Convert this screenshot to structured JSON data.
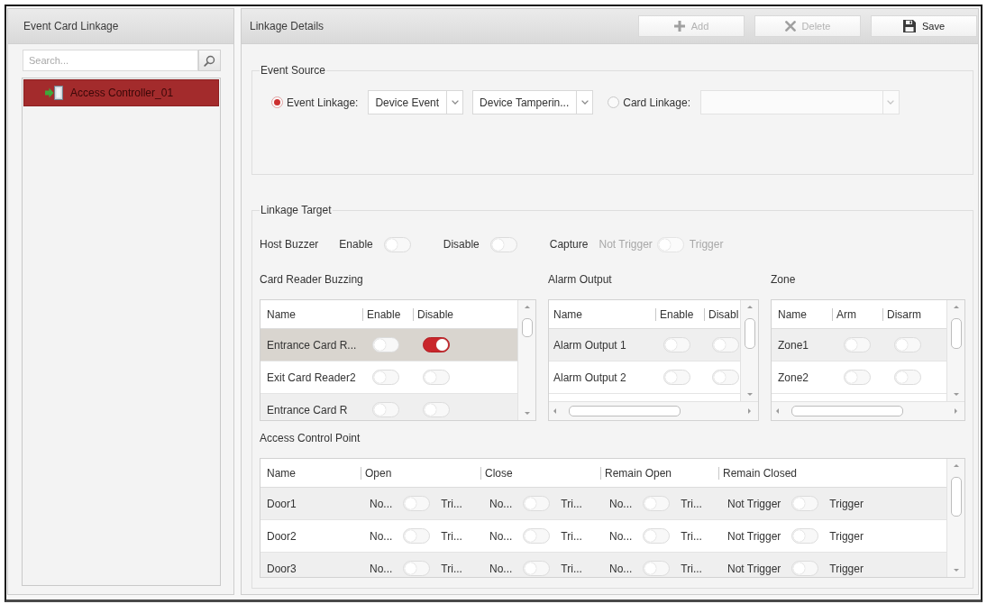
{
  "sidebar": {
    "title": "Event Card Linkage",
    "search": {
      "placeholder": "Search..."
    },
    "items": [
      {
        "label": "Access Controller_01",
        "selected": true
      }
    ]
  },
  "details": {
    "title": "Linkage Details",
    "buttons": [
      {
        "kind": "add",
        "label": "Add",
        "disabled": true
      },
      {
        "kind": "delete",
        "label": "Delete",
        "disabled": true
      },
      {
        "kind": "save",
        "label": "Save",
        "disabled": false
      }
    ],
    "event_source": {
      "title": "Event Source",
      "options": [
        {
          "label": "Event Linkage:",
          "selected": true,
          "dropdowns": [
            {
              "value": "Device Event",
              "disabled": false
            },
            {
              "value": "Device Tamperin...",
              "disabled": false
            }
          ]
        },
        {
          "label": "Card Linkage:",
          "selected": false,
          "dropdowns": [
            {
              "disabled": true
            }
          ]
        }
      ]
    },
    "linkage_target": {
      "title": "Linkage Target",
      "host_buzzer": {
        "label": "Host Buzzer",
        "options": [
          {
            "label": "Enable",
            "on": false
          },
          {
            "label": "Disable",
            "on": false
          }
        ]
      },
      "capture": {
        "label": "Capture",
        "off_label": "Not Trigger",
        "on_label": "Trigger",
        "on": false,
        "disabled": true
      },
      "card_reader_buzzing": {
        "title": "Card Reader Buzzing",
        "columns": [
          "Name",
          "Enable",
          "Disable"
        ],
        "rows": [
          {
            "name": "Entrance Card R...",
            "selected": true,
            "toggles": [
              {
                "on": false
              },
              {
                "on": true
              }
            ]
          },
          {
            "name": "Exit Card Reader2",
            "selected": false,
            "toggles": [
              {
                "on": false
              },
              {
                "on": false
              }
            ]
          },
          {
            "name": "Entrance Card R",
            "selected": false,
            "toggles": [
              {
                "on": false
              },
              {
                "on": false
              }
            ]
          }
        ]
      },
      "alarm_output": {
        "title": "Alarm Output",
        "columns": [
          "Name",
          "Enable",
          "Disabl"
        ],
        "rows": [
          {
            "name": "Alarm Output 1",
            "selected": false,
            "toggles": [
              {
                "on": false
              },
              {
                "on": false
              }
            ]
          },
          {
            "name": "Alarm Output 2",
            "selected": false,
            "toggles": [
              {
                "on": false
              },
              {
                "on": false
              }
            ]
          }
        ]
      },
      "zone": {
        "title": "Zone",
        "columns": [
          "Name",
          "Arm",
          "Disarm"
        ],
        "rows": [
          {
            "name": "Zone1",
            "selected": false,
            "toggles": [
              {
                "on": false
              },
              {
                "on": false
              }
            ]
          },
          {
            "name": "Zone2",
            "selected": false,
            "toggles": [
              {
                "on": false
              },
              {
                "on": false
              }
            ]
          }
        ]
      },
      "access_control_point": {
        "title": "Access Control Point",
        "columns": [
          "Name",
          "Open",
          "Close",
          "Remain Open",
          "Remain Closed"
        ],
        "rows": [
          {
            "name": "Door1",
            "selected": false,
            "toggles": [
              {
                "off_label": "No...",
                "on_label": "Tri...",
                "on": false
              },
              {
                "off_label": "No...",
                "on_label": "Tri...",
                "on": false
              },
              {
                "off_label": "No...",
                "on_label": "Tri...",
                "on": false
              },
              {
                "off_label": "Not Trigger",
                "on_label": "Trigger",
                "on": false
              }
            ]
          },
          {
            "name": "Door2",
            "selected": false,
            "toggles": [
              {
                "off_label": "No...",
                "on_label": "Tri...",
                "on": false
              },
              {
                "off_label": "No...",
                "on_label": "Tri...",
                "on": false
              },
              {
                "off_label": "No...",
                "on_label": "Tri...",
                "on": false
              },
              {
                "off_label": "Not Trigger",
                "on_label": "Trigger",
                "on": false
              }
            ]
          },
          {
            "name": "Door3",
            "selected": false,
            "toggles": [
              {
                "off_label": "No...",
                "on_label": "Tri...",
                "on": false
              },
              {
                "off_label": "No...",
                "on_label": "Tri...",
                "on": false
              },
              {
                "off_label": "No...",
                "on_label": "Tri...",
                "on": false
              },
              {
                "off_label": "Not Trigger",
                "on_label": "Trigger",
                "on": false
              }
            ]
          }
        ]
      }
    }
  }
}
